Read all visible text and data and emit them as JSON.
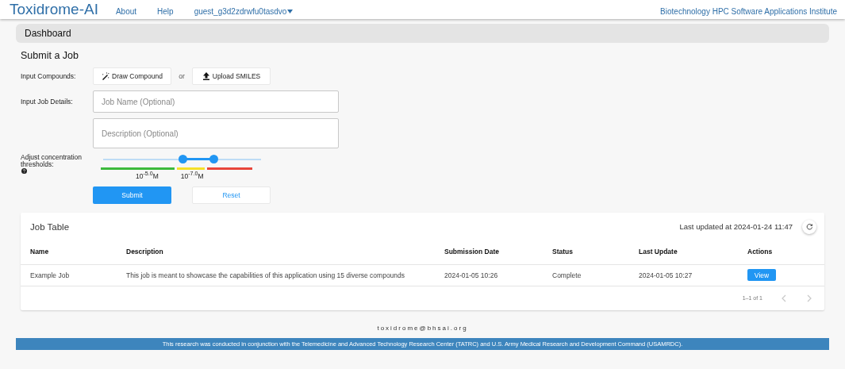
{
  "header": {
    "brand": "Toxidrome-AI",
    "nav": [
      "About",
      "Help"
    ],
    "user_menu": "guest_g3d2zdrwfu0tasdvo",
    "institute": "Biotechnology HPC Software Applications Institute"
  },
  "breadcrumb": "Dashboard",
  "submit_form": {
    "title": "Submit a Job",
    "compounds_label": "Input Compounds:",
    "draw_button": "Draw Compound",
    "or_text": "or",
    "upload_button": "Upload SMILES",
    "details_label": "Input Job Details:",
    "job_name": {
      "placeholder": "Job Name (Optional)"
    },
    "description": {
      "placeholder": "Description (Optional)"
    },
    "threshold_label": "Adjust concentration thresholds:",
    "slider": {
      "low": {
        "level": 0.5
      },
      "high": {
        "level": 0.7
      }
    },
    "threshold_values": [
      "10$^{-5.0}$M",
      "10$^{-7.0}$M"
    ],
    "submit_button": "Submit",
    "reset_button": "Reset"
  },
  "job_table": {
    "title": "Job Table",
    "last_updated": "Last updated at 2024-01-24 11:47",
    "columns": [
      "Name",
      "Description",
      "Submission Date",
      "Status",
      "Last Update",
      "Actions"
    ],
    "rows": [
      {
        "name": "Example Job",
        "description": "This job is meant to showcase the capabilities of this application using 15 diverse compounds",
        "submission_date": "2024-01-05 10:26",
        "status": "Complete",
        "last_update": "2024-01-05 10:27",
        "action": "View"
      }
    ],
    "pagination": {
      "range": "1–1 of 1",
      "prev_disabled": true,
      "next_disabled": true
    }
  },
  "footer": {
    "email": "toxidrome@bhsai.org",
    "acknowledgement": "This research was conducted in conjunction with the Telemedicine and Advanced Technology Research Center (TATRC) and U.S. Army Medical Research and Development Command (USAMRDC)."
  }
}
